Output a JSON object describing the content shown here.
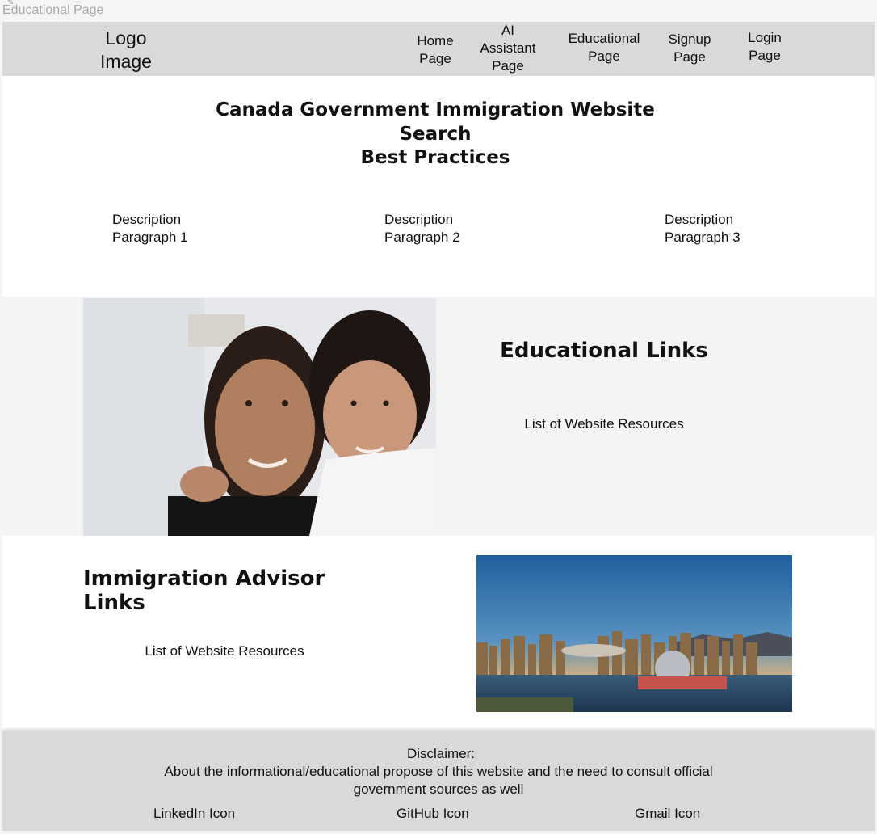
{
  "frame": {
    "label": "Educational Page"
  },
  "navbar": {
    "logo_line1": "Logo",
    "logo_line2": "Image",
    "items": [
      {
        "line1": "Home",
        "line2": "Page",
        "line3": ""
      },
      {
        "line1": "AI",
        "line2": "Assistant",
        "line3": "Page"
      },
      {
        "line1": "Educational",
        "line2": "Page",
        "line3": ""
      },
      {
        "line1": "Signup",
        "line2": "Page",
        "line3": ""
      },
      {
        "line1": "Login",
        "line2": "Page",
        "line3": ""
      }
    ]
  },
  "hero": {
    "title_line1": "Canada Government Immigration Website",
    "title_line2": "Search",
    "title_line3": "Best Practices",
    "descriptions": [
      {
        "line1": "Description",
        "line2": "Paragraph 1"
      },
      {
        "line1": "Description",
        "line2": "Paragraph 2"
      },
      {
        "line1": "Description",
        "line2": "Paragraph 3"
      }
    ]
  },
  "educational": {
    "title": "Educational Links",
    "list_text": "List of  Website Resources"
  },
  "advisor": {
    "title": "Immigration Advisor Links",
    "list_text": "List of  Website Resources"
  },
  "footer": {
    "disclaimer_head": "Disclaimer:",
    "disclaimer_line1": "About the informational/educational propose of this website and the need to consult official",
    "disclaimer_line2": "government sources as well",
    "icons": [
      "LinkedIn Icon",
      "GitHub Icon",
      "Gmail Icon"
    ]
  },
  "colors": {
    "navbar_bg": "#d9d9d9",
    "hero_bg": "#ffffff",
    "edu_bg": "#f4f4f4",
    "footer_bg": "#d9d9d9"
  }
}
